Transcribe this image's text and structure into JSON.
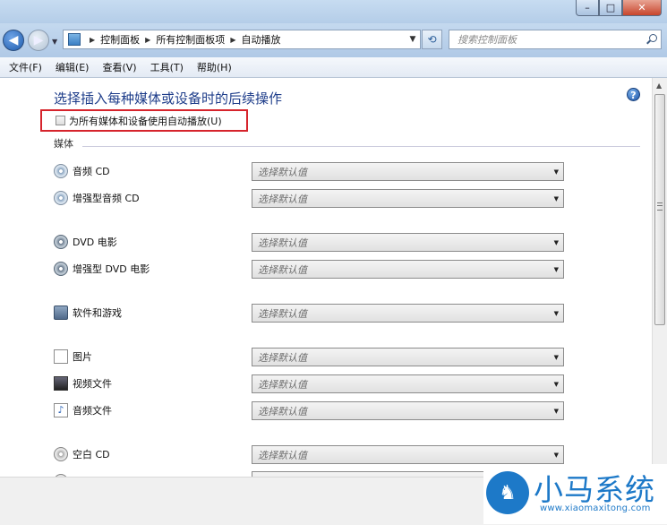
{
  "window": {
    "minimize": "–",
    "maximize": "□",
    "close": "✕"
  },
  "nav": {
    "back_icon": "back-arrow",
    "forward_icon": "forward-arrow",
    "breadcrumbs": [
      "控制面板",
      "所有控制面板项",
      "自动播放"
    ],
    "search_placeholder": "搜索控制面板"
  },
  "menu": [
    "文件(F)",
    "编辑(E)",
    "查看(V)",
    "工具(T)",
    "帮助(H)"
  ],
  "page": {
    "heading": "选择插入每种媒体或设备时的后续操作",
    "help": "?",
    "autoplay_checkbox": {
      "label": "为所有媒体和设备使用自动播放(U)",
      "checked": false
    },
    "section_media": "媒体",
    "default_placeholder": "选择默认值",
    "items": [
      {
        "label": "音频 CD",
        "icon": "audio-cd-icon"
      },
      {
        "label": "增强型音频 CD",
        "icon": "enhanced-audio-cd-icon"
      },
      {
        "label": "DVD 电影",
        "icon": "dvd-movie-icon"
      },
      {
        "label": "增强型 DVD 电影",
        "icon": "enhanced-dvd-icon"
      },
      {
        "label": "软件和游戏",
        "icon": "software-icon"
      },
      {
        "label": "图片",
        "icon": "picture-icon"
      },
      {
        "label": "视频文件",
        "icon": "video-file-icon"
      },
      {
        "label": "音频文件",
        "icon": "audio-file-icon"
      },
      {
        "label": "空白 CD",
        "icon": "blank-cd-icon"
      }
    ]
  },
  "watermark": {
    "title": "小马系统",
    "url": "www.xiaomaxitong.com"
  }
}
